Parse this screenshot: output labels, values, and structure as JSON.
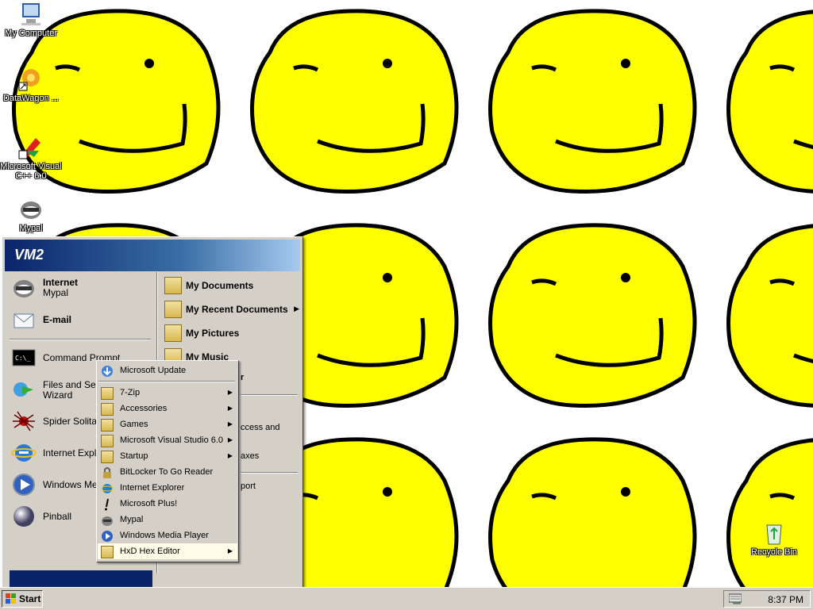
{
  "desktop": {
    "icons": [
      {
        "label": "My Computer",
        "icon": "my-computer-icon"
      },
      {
        "label": "DataWagon ...",
        "icon": "shortcut-icon"
      },
      {
        "label": "Microsoft Visual C++ 6.0",
        "icon": "visual-cpp-icon"
      },
      {
        "label": "Mypal",
        "icon": "mypal-icon"
      },
      {
        "label": "Recycle Bin",
        "icon": "recycle-bin-icon"
      }
    ],
    "wallpaper": "tiled-yellow-smiley",
    "colors": {
      "smiley": "#ffff00",
      "outline": "#000000"
    }
  },
  "start_menu": {
    "user": "VM2",
    "pinned": [
      {
        "title": "Internet",
        "subtitle": "Mypal"
      },
      {
        "title": "E-mail",
        "subtitle": ""
      }
    ],
    "recent": [
      {
        "label": "Command Prompt"
      },
      {
        "label": "Files and Settin",
        "label2": "Wizard"
      },
      {
        "label": "Spider Solitaire"
      },
      {
        "label": "Internet Explore"
      },
      {
        "label": "Windows Medi"
      },
      {
        "label": "Pinball"
      }
    ],
    "right": [
      {
        "label": "My Documents",
        "arrow": false
      },
      {
        "label": "My Recent Documents",
        "arrow": true
      },
      {
        "label": "My Pictures",
        "arrow": false
      },
      {
        "label": "My Music",
        "arrow": false
      }
    ],
    "right_partial": {
      "r1": "r",
      "r2": "ccess and",
      "r3": "axes",
      "r4": "port"
    }
  },
  "programs_menu": {
    "items": [
      {
        "label": "Microsoft Update",
        "arrow": false,
        "icon": "update-icon"
      },
      {
        "label": "7-Zip",
        "arrow": true,
        "icon": "folder-icon"
      },
      {
        "label": "Accessories",
        "arrow": true,
        "icon": "folder-icon"
      },
      {
        "label": "Games",
        "arrow": true,
        "icon": "folder-icon"
      },
      {
        "label": "Microsoft Visual Studio 6.0",
        "arrow": true,
        "icon": "folder-icon"
      },
      {
        "label": "Startup",
        "arrow": true,
        "icon": "folder-icon"
      },
      {
        "label": "BitLocker To Go Reader",
        "arrow": false,
        "icon": "bitlocker-icon"
      },
      {
        "label": "Internet Explorer",
        "arrow": false,
        "icon": "ie-icon"
      },
      {
        "label": "Microsoft Plus!",
        "arrow": false,
        "icon": "plus-icon"
      },
      {
        "label": "Mypal",
        "arrow": false,
        "icon": "mypal-icon"
      },
      {
        "label": "Windows Media Player",
        "arrow": false,
        "icon": "wmp-icon"
      },
      {
        "label": "HxD Hex Editor",
        "arrow": true,
        "icon": "folder-icon",
        "highlighted": true
      }
    ]
  },
  "taskbar": {
    "start_label": "Start",
    "clock": "8:37 PM"
  }
}
